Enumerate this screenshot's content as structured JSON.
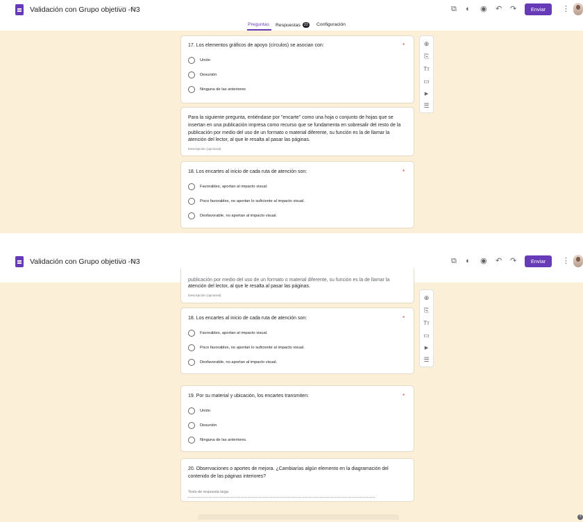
{
  "app": {
    "doc_title": "Validación con Grupo objetivo -N3",
    "send_label": "Enviar",
    "top_icons": [
      "folder-icon",
      "star-icon",
      "addon-icon",
      "palette-icon",
      "preview-eye-icon",
      "undo-icon",
      "redo-icon",
      "more-vert-icon"
    ]
  },
  "tabs": {
    "questions": "Preguntas",
    "responses": "Respuestas",
    "responses_count": "22",
    "settings": "Configuración"
  },
  "toolbar_icons": [
    "add-question-icon",
    "import-questions-icon",
    "add-title-icon",
    "add-image-icon",
    "add-video-icon",
    "add-section-icon"
  ],
  "glyphs": {
    "folder": "🗀",
    "star": "☆",
    "addon": "⧉",
    "palette": "◐",
    "eye": "◉",
    "undo": "↶",
    "redo": "↷",
    "more": "⋮",
    "add": "⊕",
    "import": "⎘",
    "text": "Tт",
    "image": "▭",
    "video": "▶",
    "section": "☰",
    "help": "?"
  },
  "q17": {
    "title": "17. Los elementos gráficos de apoyo (círculos) se asocian con:",
    "required": "*",
    "options": [
      "Unión",
      "Desunión",
      "Ninguna de las anteriores"
    ]
  },
  "desc": {
    "text": "Para la siguiente pregunta, entiéndase por \"encarte\" como una hoja o conjunto de hojas que se insertan en una publicación impresa como recurso que se fundamenta en sobresalir del resto de la publicación por medio del uso de un formato o material diferente, su función es la de llamar la atención del lector, al que le resalta al pasar las páginas.",
    "hint": "Descripción (opcional)",
    "partial_line_1": "publicación por medio del uso de un formato o material diferente, su función es la de llamar la",
    "partial_line_2": "atención del lector, al que le resalta al pasar las páginas."
  },
  "q18": {
    "title": "18. Los encartes al inicio de cada ruta de atención son:",
    "required": "*",
    "options": [
      "Favorables, aportan al impacto visual.",
      "Poco favorables, no aportan lo suficiente al impacto visual.",
      "Desfavorable, no aportan al impacto visual."
    ]
  },
  "q19": {
    "title": "19. Por su material y ubicación, los encartes transmiten:",
    "required": "*",
    "options": [
      "Unión",
      "Desunión",
      "Ninguna de las anteriores."
    ]
  },
  "q20": {
    "title_line_1": "20. Observaciones o aportes de mejora. ¿Cambiarías algún elemento en la diagramación del",
    "title_line_2": "contenido de las páginas interiores?",
    "placeholder": "Texto de respuesta larga"
  },
  "colors": {
    "accent": "#673ab7",
    "background": "#fcefd8",
    "required": "#d93025"
  }
}
